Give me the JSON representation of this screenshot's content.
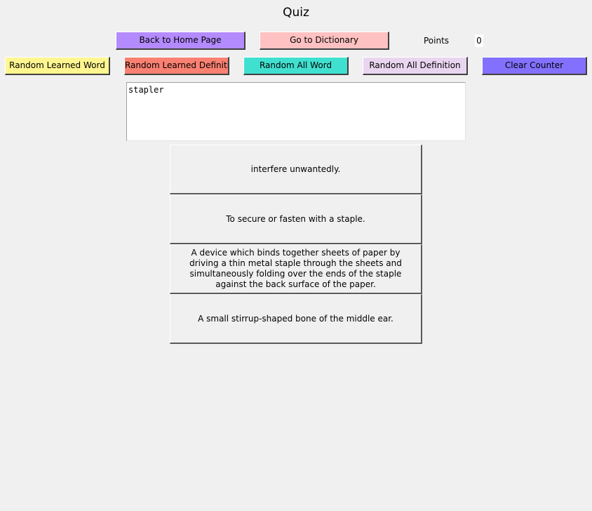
{
  "window": {
    "title": "Quiz"
  },
  "nav": {
    "home_label": "Back to Home Page",
    "dictionary_label": "Go to Dictionary"
  },
  "points": {
    "label": "Points",
    "value": "0"
  },
  "toolbar": {
    "random_learned_word": "Random Learned Word",
    "random_learned_definition": "Random Learned Definition",
    "random_all_word": "Random All Word",
    "random_all_definition": "Random All Definition",
    "clear_counter": "Clear Counter"
  },
  "question": {
    "word": "stapler"
  },
  "answers": [
    {
      "text": "interfere unwantedly."
    },
    {
      "text": "To secure or fasten with a staple."
    },
    {
      "text": "A device which binds together sheets of paper by driving a thin metal staple through the sheets and simultaneously folding over the ends of the staple against the back surface of the paper."
    },
    {
      "text": "A small stirrup-shaped bone of the middle ear."
    }
  ],
  "colors": {
    "background": "#f0f0f0",
    "home_button": "#b48aff",
    "dictionary_button": "#ffc1c1",
    "random_learned_word_button": "#fff68f",
    "random_learned_definition_button": "#fa8072",
    "random_all_word_button": "#40e0d0",
    "random_all_definition_button": "#ead5f0",
    "clear_counter_button": "#8470ff"
  }
}
